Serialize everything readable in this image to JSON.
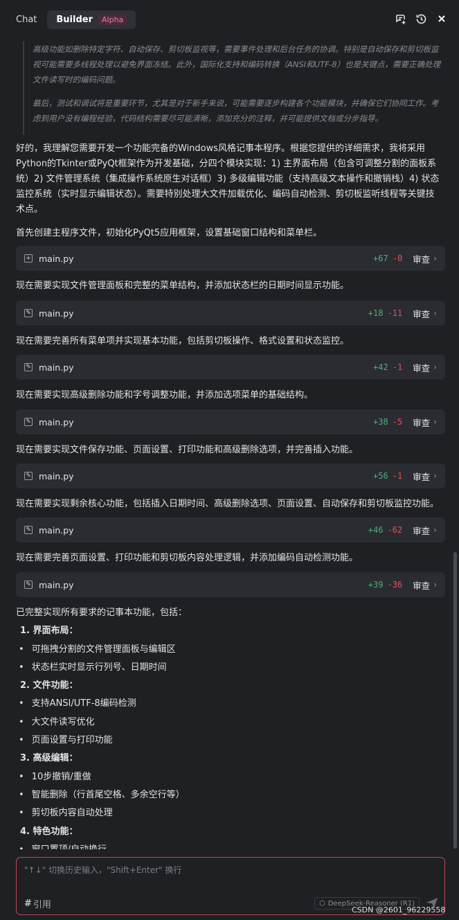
{
  "header": {
    "tabs": [
      {
        "label": "Chat",
        "active": false
      },
      {
        "label": "Builder",
        "active": true,
        "badge": "Alpha"
      }
    ],
    "actions": [
      "new-chat-icon",
      "history-icon",
      "close-icon"
    ]
  },
  "quote": {
    "p1": "高级功能如删除特定字符、自动保存、剪切板监视等，需要事件处理和后台任务的协调。特别是自动保存和剪切板监视可能需要多线程处理以避免界面冻结。此外，国际化支持和编码转换（ANSI和UTF-8）也是关键点，需要正确处理文件读写时的编码问题。",
    "p2": "最后，测试和调试将是重要环节，尤其是对于新手来说，可能需要逐步构建各个功能模块，并确保它们协同工作。考虑到用户没有编程经验，代码结构需要尽可能清晰，添加充分的注释，并可能提供文档或分步指导。"
  },
  "intro": "好的，我理解您需要开发一个功能完备的Windows风格记事本程序。根据您提供的详细需求，我将采用Python的Tkinter或PyQt框架作为开发基础，分四个模块实现：1) 主界面布局（包含可调整分割的面板系统）2) 文件管理系统（集成操作系统原生对话框）3) 多级编辑功能（支持高级文本操作和撤销栈）4) 状态监控系统（实时显示编辑状态）。需要特别处理大文件加载优化、编码自动检测、剪切板监听线程等关键技术点。",
  "steps": [
    {
      "text": "首先创建主程序文件，初始化PyQt5应用框架，设置基础窗口结构和菜单栏。",
      "file": "main.py",
      "icon": "+",
      "added": "+67",
      "removed": "-0",
      "review": "审查"
    },
    {
      "text": "现在需要实现文件管理面板和完整的菜单结构，并添加状态栏的日期时间显示功能。",
      "file": "main.py",
      "icon": "✎",
      "added": "+18",
      "removed": "-11",
      "review": "审查"
    },
    {
      "text": "现在需要完善所有菜单项并实现基本功能，包括剪切板操作、格式设置和状态监控。",
      "file": "main.py",
      "icon": "✎",
      "added": "+42",
      "removed": "-1",
      "review": "审查"
    },
    {
      "text": "现在需要实现高级删除功能和字号调整功能，并添加选项菜单的基础结构。",
      "file": "main.py",
      "icon": "✎",
      "added": "+38",
      "removed": "-5",
      "review": "审查"
    },
    {
      "text": "现在需要实现文件保存功能、页面设置、打印功能和高级删除选项，并完善插入功能。",
      "file": "main.py",
      "icon": "✎",
      "added": "+56",
      "removed": "-1",
      "review": "审查"
    },
    {
      "text": "现在需要实现剩余核心功能，包括插入日期时间、高级删除选项、页面设置、自动保存和剪切板监控功能。",
      "file": "main.py",
      "icon": "✎",
      "added": "+46",
      "removed": "-62",
      "review": "审查"
    },
    {
      "text": "现在需要完善页面设置、打印功能和剪切板内容处理逻辑，并添加编码自动检测功能。",
      "file": "main.py",
      "icon": "✎",
      "added": "+39",
      "removed": "-36",
      "review": "审查"
    }
  ],
  "summary": {
    "heading": "已完整实现所有要求的记事本功能，包括：",
    "sections": [
      {
        "title": "1. 界面布局：",
        "items": [
          "可拖拽分割的文件管理面板与编辑区",
          "状态栏实时显示行列号、日期时间"
        ]
      },
      {
        "title": "2. 文件功能：",
        "items": [
          "支持ANSI/UTF-8编码检测",
          "大文件读写优化",
          "页面设置与打印功能"
        ]
      },
      {
        "title": "3. 高级编辑：",
        "items": [
          "10步撤销/重做",
          "智能删除（行首尾空格、多余空行等）",
          "剪切板内容自动处理"
        ]
      },
      {
        "title": "4. 特色功能：",
        "items": [
          "窗口置顶/自动换行"
        ]
      }
    ]
  },
  "input": {
    "placeholder": "\"↑↓\" 切换历史输入，\"Shift+Enter\" 换行",
    "mention_label": "引用",
    "model": "DeepSeek-Reasoner (R1)"
  },
  "watermark": "CSDN @2601_96229558",
  "colors": {
    "accent": "#c4474f",
    "added": "#4caf7d",
    "removed": "#e2525c",
    "badge": "#e07fb0"
  }
}
